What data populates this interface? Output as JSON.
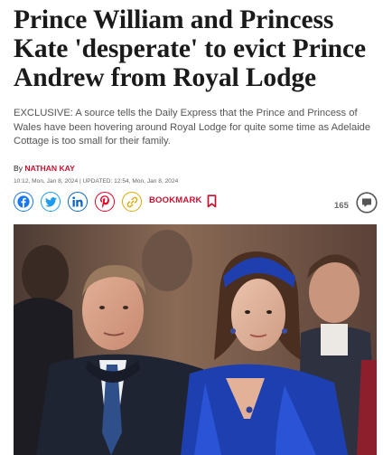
{
  "article": {
    "headline": "Prince William and Princess Kate 'desperate' to evict Prince Andrew from Royal Lodge",
    "standfirst": "EXCLUSIVE: A source tells the Daily Express that the Prince and Princess of Wales have been hovering around Royal Lodge for quite some time as Adelaide Cottage is too small for their family.",
    "byline_prefix": "By",
    "author": "NATHAN KAY",
    "dateline": "10:12, Mon, Jan 8, 2024 | UPDATED: 12:54, Mon, Jan 8, 2024"
  },
  "share": {
    "icons": [
      "facebook-icon",
      "twitter-icon",
      "linkedin-icon",
      "pinterest-icon",
      "copy-link-icon"
    ],
    "bookmark_label": "BOOKMARK",
    "comment_count": "165"
  },
  "colors": {
    "brand_red": "#c8102e",
    "facebook": "#1877f2",
    "twitter": "#1d9bf0",
    "linkedin": "#0a66c2",
    "pinterest": "#e60023",
    "copy_link": "#e0a800"
  }
}
